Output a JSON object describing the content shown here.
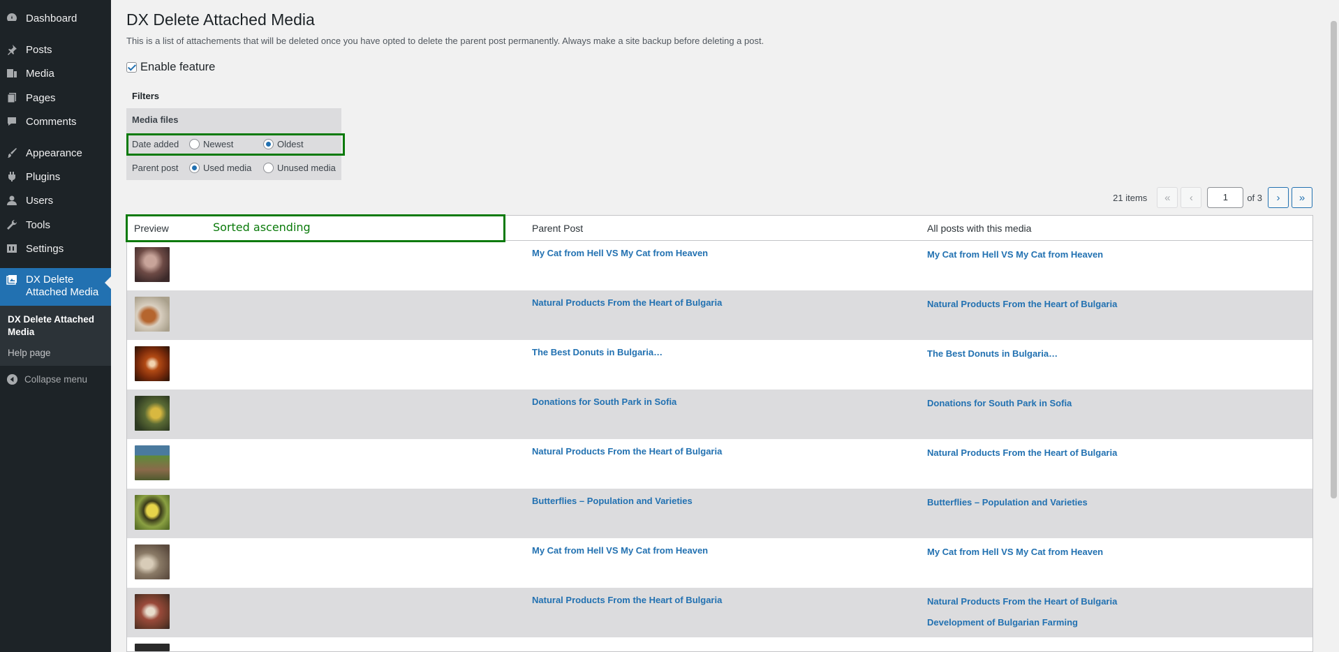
{
  "sidebar": {
    "items": [
      {
        "label": "Dashboard",
        "icon": "dashboard-icon"
      },
      {
        "label": "Posts",
        "icon": "pin-icon"
      },
      {
        "label": "Media",
        "icon": "media-icon"
      },
      {
        "label": "Pages",
        "icon": "pages-icon"
      },
      {
        "label": "Comments",
        "icon": "comments-icon"
      },
      {
        "label": "Appearance",
        "icon": "brush-icon"
      },
      {
        "label": "Plugins",
        "icon": "plugin-icon"
      },
      {
        "label": "Users",
        "icon": "user-icon"
      },
      {
        "label": "Tools",
        "icon": "wrench-icon"
      },
      {
        "label": "Settings",
        "icon": "settings-icon"
      },
      {
        "label": "DX Delete Attached Media",
        "icon": "gallery-icon"
      }
    ],
    "submenu": [
      "DX Delete Attached Media",
      "Help page"
    ],
    "collapse_label": "Collapse menu"
  },
  "page": {
    "title": "DX Delete Attached Media",
    "description": "This is a list of attachements that will be deleted once you have opted to delete the parent post permanently. Always make a site backup before deleting a post.",
    "enable_label": "Enable feature",
    "enable_checked": true
  },
  "filters": {
    "title": "Filters",
    "head": "Media files",
    "date_label": "Date added",
    "date_options": [
      "Newest",
      "Oldest"
    ],
    "date_selected": "Oldest",
    "parent_label": "Parent post",
    "parent_options": [
      "Used media",
      "Unused media"
    ],
    "parent_selected": "Used media"
  },
  "annotation": {
    "sorted_text": "Sorted ascending",
    "color": "#0a7a0a"
  },
  "pagination": {
    "count": "21 items",
    "first": "«",
    "prev": "‹",
    "current": "1",
    "of": "of 3",
    "next": "›",
    "last": "»"
  },
  "table": {
    "columns": [
      "Preview",
      "Parent Post",
      "All posts with this media"
    ],
    "rows": [
      {
        "parent": "My Cat from Hell VS My Cat from Heaven",
        "all": [
          "My Cat from Hell VS My Cat from Heaven"
        ],
        "thumb": "cat-thumbnail"
      },
      {
        "parent": "Natural Products From the Heart of Bulgaria",
        "all": [
          "Natural Products From the Heart of Bulgaria"
        ],
        "thumb": "hens-thumbnail"
      },
      {
        "parent": "The Best Donuts in Bulgaria…",
        "all": [
          "The Best Donuts in Bulgaria…"
        ],
        "thumb": "donut-thumbnail"
      },
      {
        "parent": "Donations for South Park in Sofia",
        "all": [
          "Donations for South Park in Sofia"
        ],
        "thumb": "park-thumbnail"
      },
      {
        "parent": "Natural Products From the Heart of Bulgaria",
        "all": [
          "Natural Products From the Heart of Bulgaria"
        ],
        "thumb": "farm-thumbnail"
      },
      {
        "parent": "Butterflies – Population and Varieties",
        "all": [
          "Butterflies – Population and Varieties"
        ],
        "thumb": "butterfly-thumbnail"
      },
      {
        "parent": "My Cat from Hell VS My Cat from Heaven",
        "all": [
          "My Cat from Hell VS My Cat from Heaven"
        ],
        "thumb": "cat-paw-thumbnail"
      },
      {
        "parent": "Natural Products From the Heart of Bulgaria",
        "all": [
          "Natural Products From the Heart of Bulgaria",
          "Development of Bulgarian Farming"
        ],
        "thumb": "chickens-thumbnail"
      }
    ]
  },
  "colors": {
    "sidebar_bg": "#1d2327",
    "accent": "#2271b1",
    "row_alt": "#dcdcde"
  }
}
